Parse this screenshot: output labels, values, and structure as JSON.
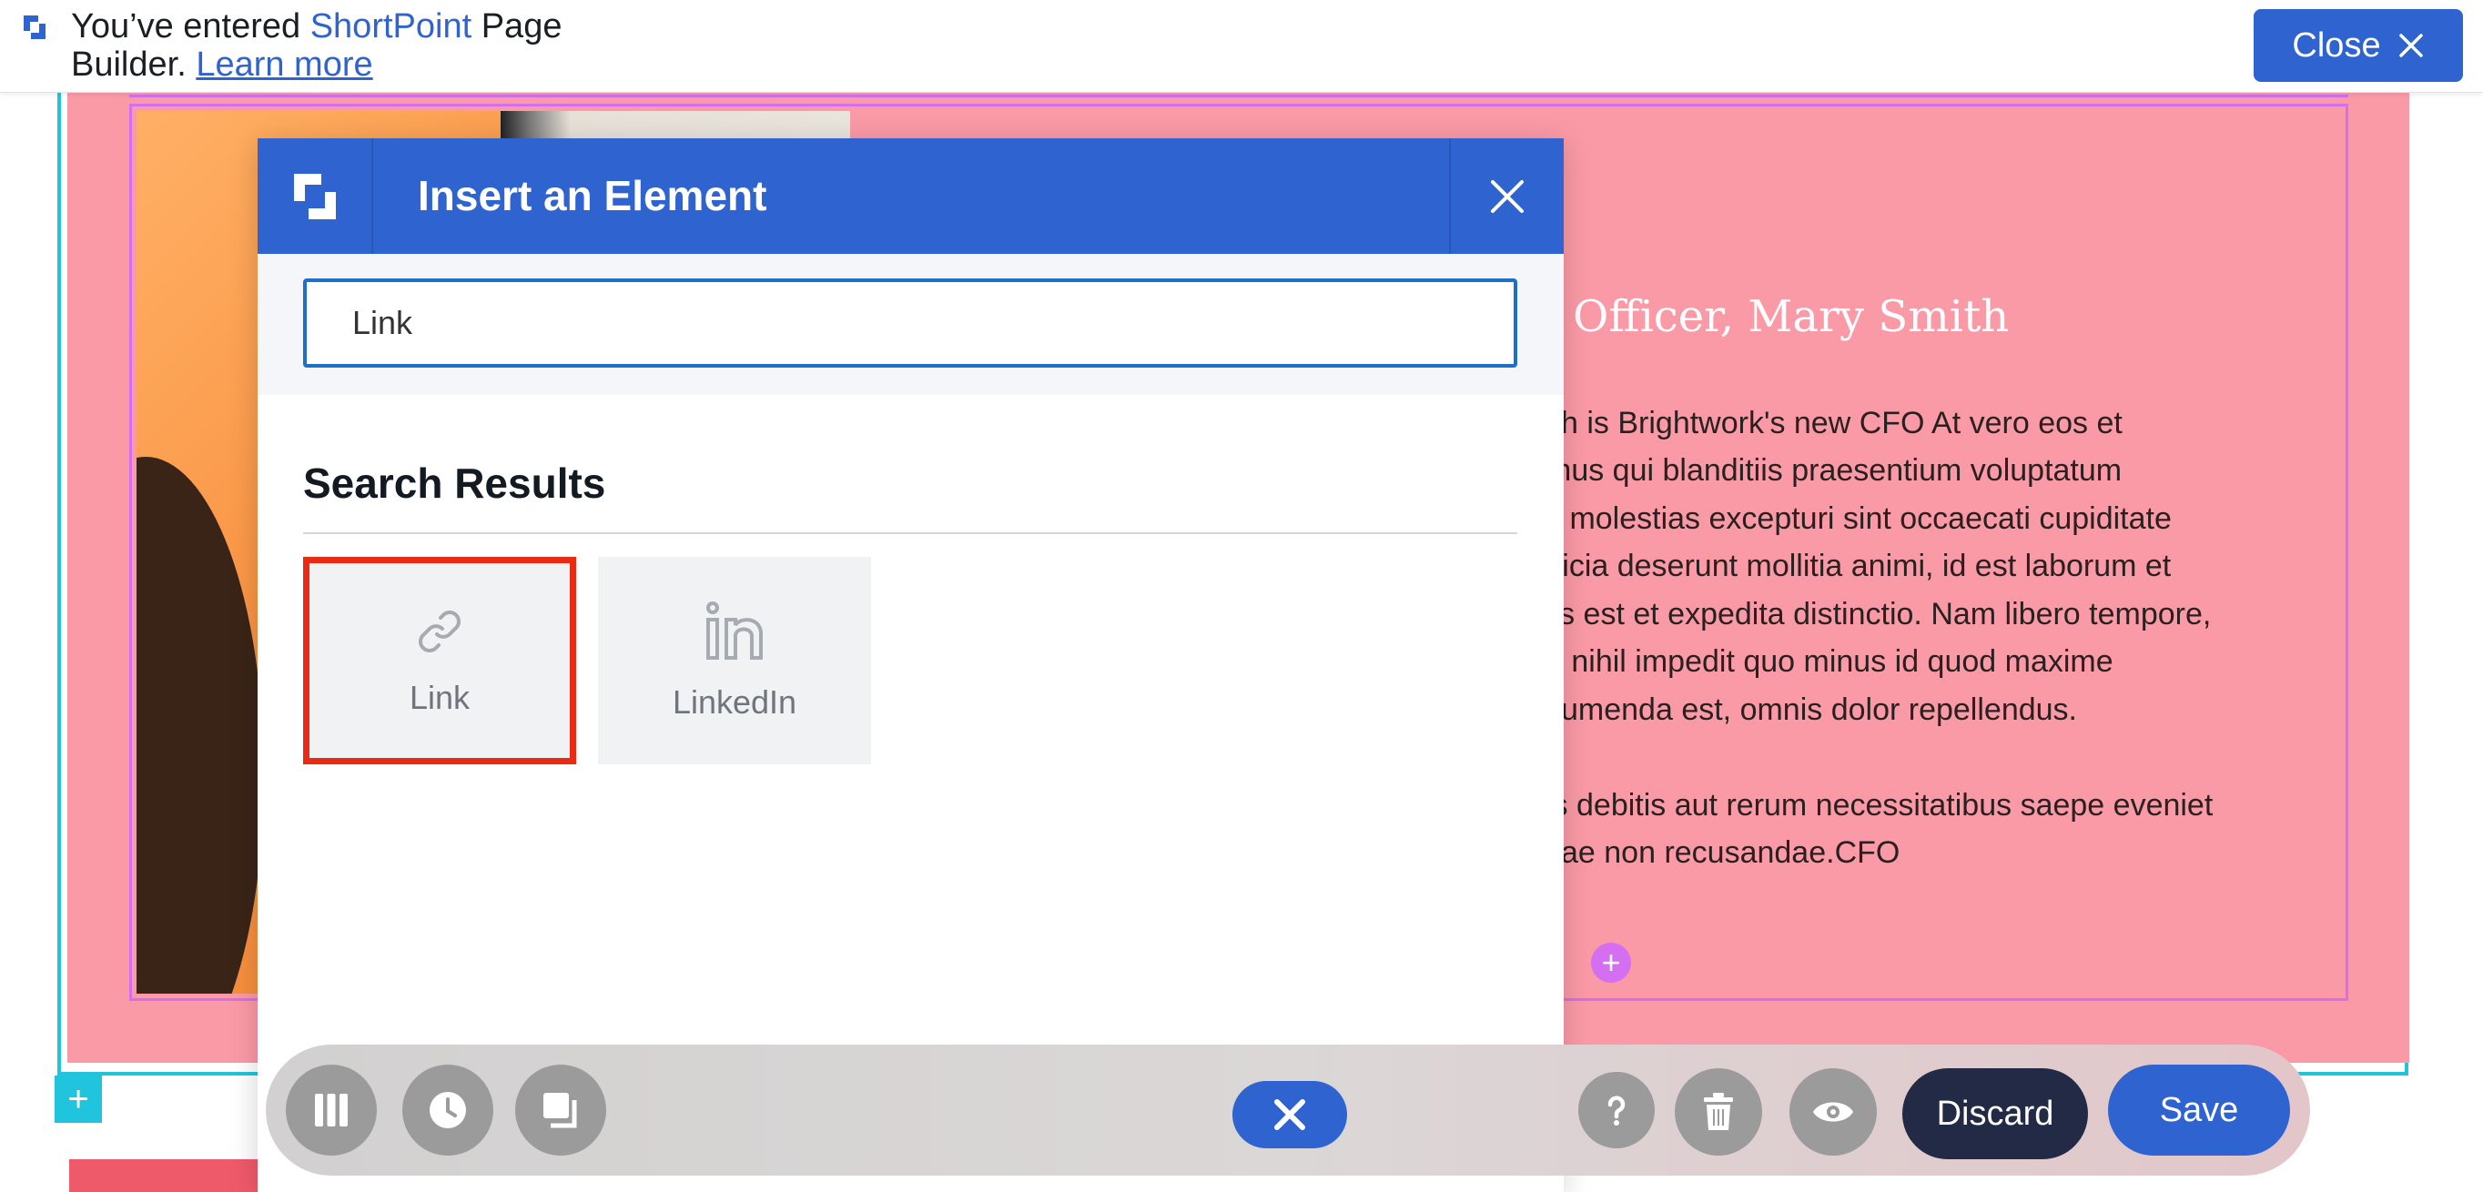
{
  "notice": {
    "prefix": "You’ve entered ",
    "brand": "ShortPoint",
    "suffix": " Page Builder. ",
    "learn_more": "Learn more",
    "close_label": "Close"
  },
  "page": {
    "heading": "Officer, Mary Smith",
    "body_lines": [
      "ith is Brightwork's new CFO At vero eos et",
      "mus qui blanditiis praesentium voluptatum",
      "s molestias excepturi sint occaecati cupiditate",
      "fficia deserunt mollitia animi, id est laborum et",
      "lis est et expedita distinctio. Nam libero tempore,",
      "e nihil impedit quo minus id quod maxime",
      "sumenda est, omnis dolor repellendus.",
      "is debitis aut rerum necessitatibus saepe eveniet",
      "tiae non recusandae.CFO"
    ]
  },
  "modal": {
    "title": "Insert an Element",
    "search_value": "Link",
    "results_title": "Search Results",
    "results": [
      {
        "label": "Link",
        "icon": "link-icon",
        "selected": true
      },
      {
        "label": "LinkedIn",
        "icon": "linkedin-icon",
        "selected": false
      }
    ]
  },
  "toolbar": {
    "discard_label": "Discard",
    "save_label": "Save",
    "icons": [
      "columns-icon",
      "history-icon",
      "copy-icon",
      "cancel-icon",
      "help-icon",
      "trash-icon",
      "preview-icon"
    ]
  },
  "colors": {
    "brand_blue": "#2f63d0",
    "section_pink": "#fb9aa7",
    "outline_purple": "#d36ff0",
    "frame_cyan": "#20c5dd",
    "selection_red": "#ea2a12"
  }
}
